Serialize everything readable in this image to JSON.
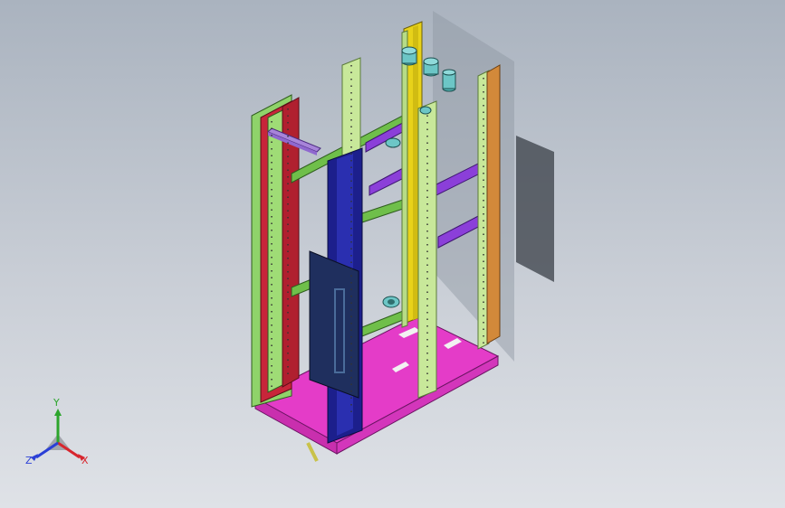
{
  "viewport": {
    "background_top": "#aab3bf",
    "background_bottom": "#dfe2e7"
  },
  "model_colors": {
    "light_green": "#c8e89a",
    "green": "#8fd36a",
    "red": "#c8253a",
    "magenta": "#e43cc8",
    "purple": "#8b3fd9",
    "navy": "#1c1f8c",
    "dark_panel": "#1f2f5e",
    "yellow": "#e8d21a",
    "orange": "#d2893a",
    "teal": "#4fb0b0"
  },
  "triad": {
    "x_label": "X",
    "y_label": "Y",
    "z_label": "Z",
    "x_color": "#d7262e",
    "y_color": "#2ca52c",
    "z_color": "#2a3fd6"
  }
}
